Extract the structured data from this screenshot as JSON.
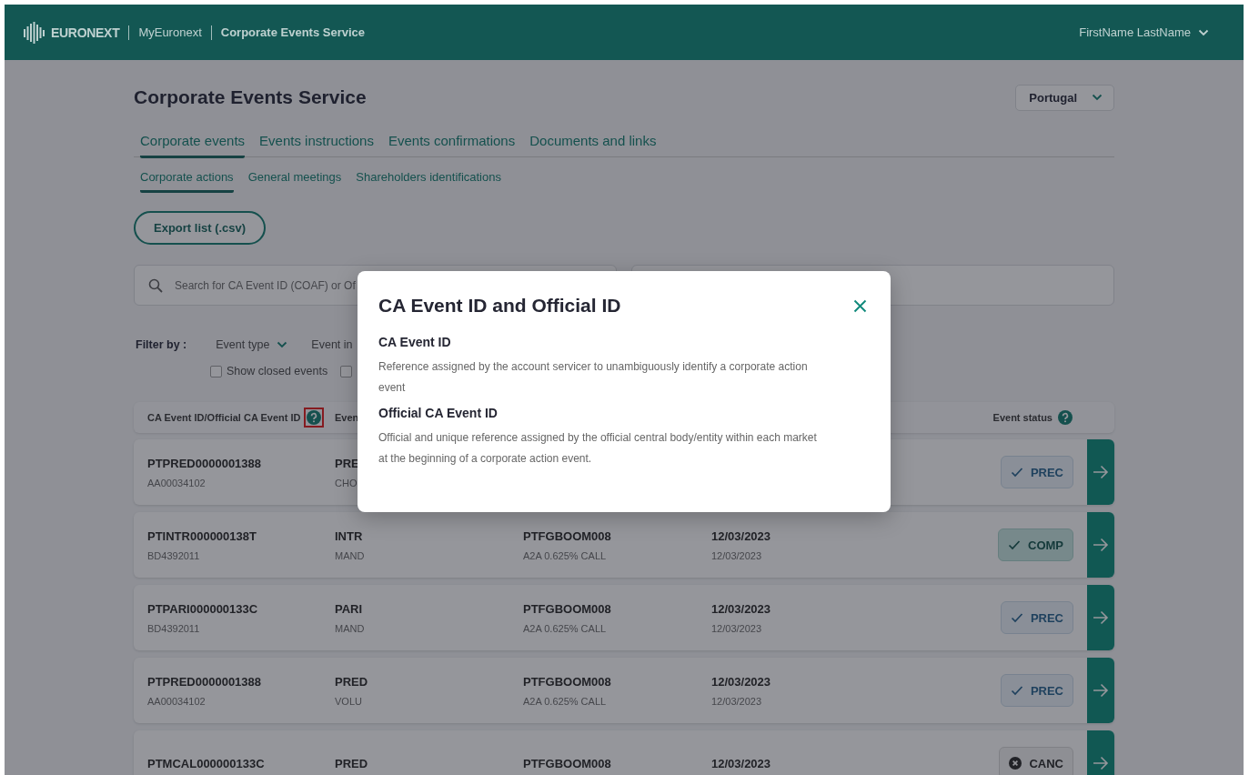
{
  "header": {
    "logo_text": "EURONEXT",
    "links": [
      {
        "label": "MyEuronext",
        "current": false
      },
      {
        "label": "Corporate Events Service",
        "current": true
      }
    ],
    "user": "FirstName LastName"
  },
  "page": {
    "title": "Corporate Events Service",
    "country": "Portugal"
  },
  "tabs": [
    {
      "label": "Corporate events",
      "selected": true
    },
    {
      "label": "Events instructions",
      "selected": false
    },
    {
      "label": "Events confirmations",
      "selected": false
    },
    {
      "label": "Documents and links",
      "selected": false
    }
  ],
  "subtabs": [
    {
      "label": "Corporate actions",
      "selected": true
    },
    {
      "label": "General meetings",
      "selected": false
    },
    {
      "label": "Shareholders identifications",
      "selected": false
    }
  ],
  "export_button": "Export list (.csv)",
  "search": {
    "placeholder": "Search for CA Event ID (COAF) or Of"
  },
  "filters": {
    "label": "Filter by :",
    "dropdowns": [
      {
        "label": "Event type",
        "caret": true
      },
      {
        "label": "Event in"
      }
    ],
    "checkboxes": [
      {
        "label": "Show closed events",
        "checked": false
      },
      {
        "checked": false
      }
    ]
  },
  "table": {
    "columns": [
      {
        "label": "CA Event ID/Official CA Event ID",
        "help": true,
        "highlighted": true
      },
      {
        "label": "Even",
        "help": false
      },
      {
        "label": "Event status",
        "help": true
      }
    ],
    "rows": [
      {
        "id": "PTPRED0000001388",
        "official_id": "AA00034102",
        "event": "PRE",
        "event_sub": "CHO",
        "status": "PREC",
        "kind": "prec"
      },
      {
        "id": "PTINTR000000138T",
        "official_id": "BD4392011",
        "event": "INTR",
        "event_sub": "MAND",
        "isin": "PTFGBOOM008",
        "name": "A2A 0.625% CALL",
        "date": "12/03/2023",
        "date_sub": "12/03/2023",
        "status": "COMP",
        "kind": "comp"
      },
      {
        "id": "PTPARI000000133C",
        "official_id": "BD4392011",
        "event": "PARI",
        "event_sub": "MAND",
        "isin": "PTFGBOOM008",
        "name": "A2A 0.625% CALL",
        "date": "12/03/2023",
        "date_sub": "12/03/2023",
        "status": "PREC",
        "kind": "prec"
      },
      {
        "id": "PTPRED0000001388",
        "official_id": "AA00034102",
        "event": "PRED",
        "event_sub": "VOLU",
        "isin": "PTFGBOOM008",
        "name": "A2A 0.625% CALL",
        "date": "12/03/2023",
        "date_sub": "12/03/2023",
        "status": "PREC",
        "kind": "prec"
      },
      {
        "id": "PTMCAL000000133C",
        "event": "PRED",
        "isin": "PTFGBOOM008",
        "date": "12/03/2023",
        "status": "CANC",
        "kind": "canc"
      }
    ]
  },
  "modal": {
    "title": "CA Event ID and Official ID",
    "sections": [
      {
        "heading": "CA Event ID",
        "text": "Reference assigned by the account servicer to unambiguously identify a corporate action event"
      },
      {
        "heading": "Official CA Event ID",
        "text": "Official and unique reference assigned by the official central body/entity within each market at the beginning of a corporate action event."
      }
    ]
  }
}
